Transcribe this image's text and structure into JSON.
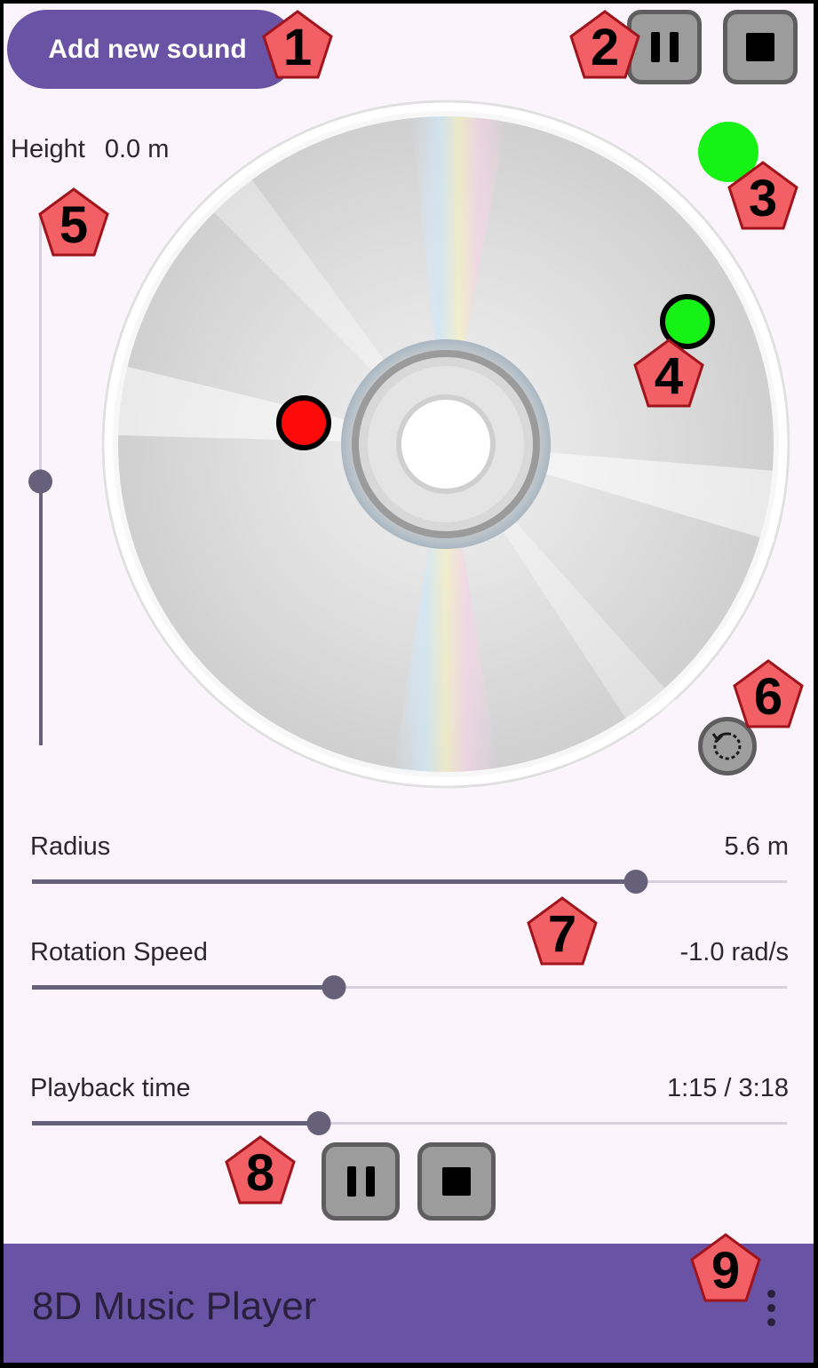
{
  "toolbar": {
    "add_sound_label": "Add new sound",
    "pause_icon": "pause-icon",
    "stop_icon": "stop-icon"
  },
  "status": {
    "color": "#16f216"
  },
  "height": {
    "label": "Height",
    "value": "0.0 m",
    "level": 0.5
  },
  "disc": {
    "listener_color": "#ff0a0a",
    "source_color": "#16f216",
    "reset_icon": "reset-rotation-icon"
  },
  "radius": {
    "label": "Radius",
    "value": "5.6 m",
    "level": 0.8
  },
  "rotation": {
    "label": "Rotation Speed",
    "value": "-1.0 rad/s",
    "level": 0.4
  },
  "playback": {
    "label": "Playback time",
    "value": "1:15 / 3:18",
    "level": 0.38
  },
  "app": {
    "title": "8D Music Player",
    "menu_icon": "more-vert-icon",
    "accent": "#6a52a4"
  },
  "badges": [
    "1",
    "2",
    "3",
    "4",
    "5",
    "6",
    "7",
    "8",
    "9"
  ]
}
